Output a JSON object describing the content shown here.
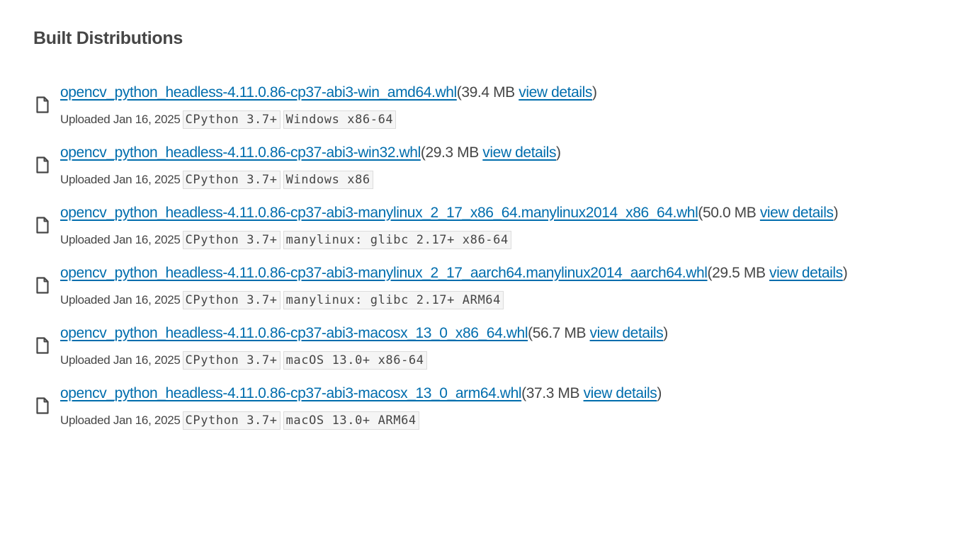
{
  "section_title": "Built Distributions",
  "common": {
    "view_details": "view details",
    "uploaded_prefix": "Uploaded",
    "open_paren": "(",
    "close_paren": ")"
  },
  "files": [
    {
      "filename": "opencv_python_headless-4.11.0.86-cp37-abi3-win_amd64.whl",
      "size": "39.4 MB",
      "uploaded": "Jan 16, 2025",
      "tags": [
        "CPython 3.7+",
        "Windows x86-64"
      ]
    },
    {
      "filename": "opencv_python_headless-4.11.0.86-cp37-abi3-win32.whl",
      "size": "29.3 MB",
      "uploaded": "Jan 16, 2025",
      "tags": [
        "CPython 3.7+",
        "Windows x86"
      ]
    },
    {
      "filename": "opencv_python_headless-4.11.0.86-cp37-abi3-manylinux_2_17_x86_64.manylinux2014_x86_64.whl",
      "size": "50.0 MB",
      "uploaded": "Jan 16, 2025",
      "tags": [
        "CPython 3.7+",
        "manylinux: glibc 2.17+ x86-64"
      ]
    },
    {
      "filename": "opencv_python_headless-4.11.0.86-cp37-abi3-manylinux_2_17_aarch64.manylinux2014_aarch64.whl",
      "size": "29.5 MB",
      "uploaded": "Jan 16, 2025",
      "tags": [
        "CPython 3.7+",
        "manylinux: glibc 2.17+ ARM64"
      ]
    },
    {
      "filename": "opencv_python_headless-4.11.0.86-cp37-abi3-macosx_13_0_x86_64.whl",
      "size": "56.7 MB",
      "uploaded": "Jan 16, 2025",
      "tags": [
        "CPython 3.7+",
        "macOS 13.0+ x86-64"
      ]
    },
    {
      "filename": "opencv_python_headless-4.11.0.86-cp37-abi3-macosx_13_0_arm64.whl",
      "size": "37.3 MB",
      "uploaded": "Jan 16, 2025",
      "tags": [
        "CPython 3.7+",
        "macOS 13.0+ ARM64"
      ]
    }
  ],
  "icons": {
    "file": "file-icon"
  },
  "colors": {
    "link": "#006dad",
    "text": "#464646",
    "tag_bg": "#f5f5f5",
    "tag_border": "#dcdcdc"
  }
}
